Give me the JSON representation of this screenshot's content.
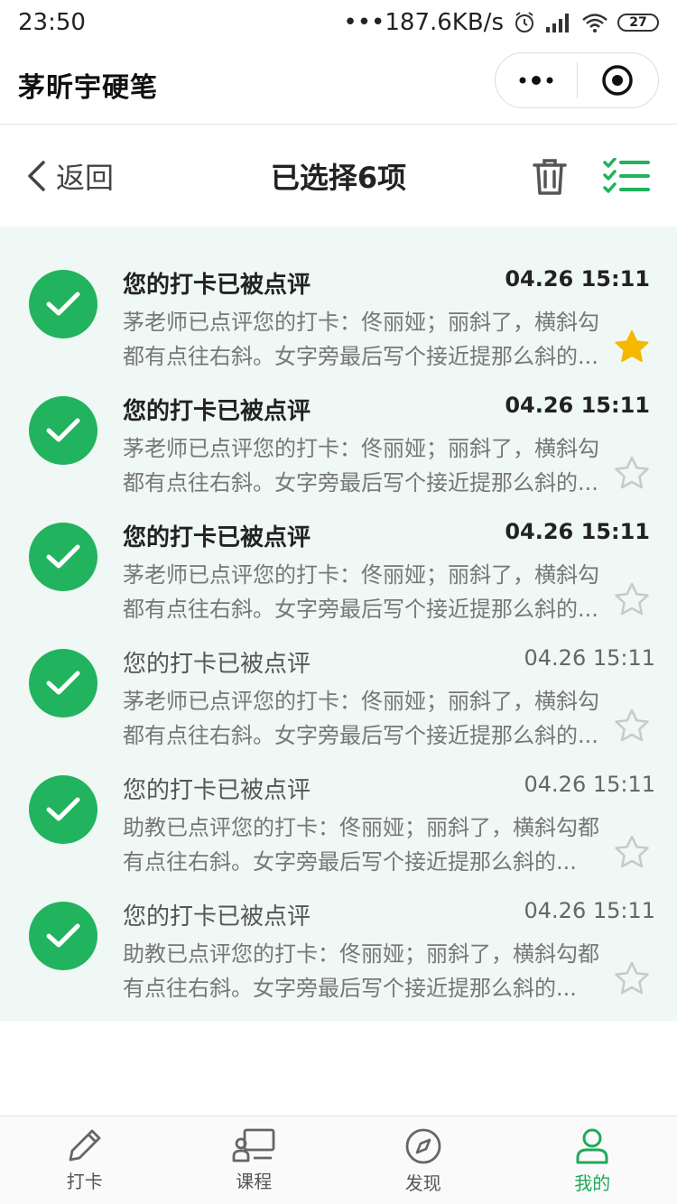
{
  "status": {
    "time": "23:50",
    "net_speed": "•••187.6KB/s",
    "battery": "27"
  },
  "app": {
    "title": "茅昕宇硬笔"
  },
  "header": {
    "back_label": "返回",
    "selection_title": "已选择6项"
  },
  "colors": {
    "accent": "#22b35e",
    "list_bg": "#eff8f4",
    "star_on": "#f5b800",
    "star_off": "#c9c9c9"
  },
  "items": [
    {
      "title": "您的打卡已被点评",
      "time": "04.26 15:11",
      "line1": "茅老师已点评您的打卡：佟丽娅；丽斜了，横斜勾",
      "line2": "都有点往右斜。女字旁最后写个接近提那么斜的...",
      "starred": true,
      "unread": true
    },
    {
      "title": "您的打卡已被点评",
      "time": "04.26 15:11",
      "line1": "茅老师已点评您的打卡：佟丽娅；丽斜了，横斜勾",
      "line2": "都有点往右斜。女字旁最后写个接近提那么斜的...",
      "starred": false,
      "unread": true
    },
    {
      "title": "您的打卡已被点评",
      "time": "04.26 15:11",
      "line1": "茅老师已点评您的打卡：佟丽娅；丽斜了，横斜勾",
      "line2": "都有点往右斜。女字旁最后写个接近提那么斜的...",
      "starred": false,
      "unread": true
    },
    {
      "title": "您的打卡已被点评",
      "time": "04.26 15:11",
      "line1": "茅老师已点评您的打卡：佟丽娅；丽斜了，横斜勾",
      "line2": "都有点往右斜。女字旁最后写个接近提那么斜的...",
      "starred": false,
      "unread": false
    },
    {
      "title": "您的打卡已被点评",
      "time": "04.26 15:11",
      "line1": "助教已点评您的打卡：佟丽娅；丽斜了，横斜勾都",
      "line2": "有点往右斜。女字旁最后写个接近提那么斜的...",
      "starred": false,
      "unread": false
    },
    {
      "title": "您的打卡已被点评",
      "time": "04.26 15:11",
      "line1": "助教已点评您的打卡：佟丽娅；丽斜了，横斜勾都",
      "line2": "有点往右斜。女字旁最后写个接近提那么斜的...",
      "starred": false,
      "unread": false
    }
  ],
  "tabs": [
    {
      "label": "打卡",
      "icon": "pencil-icon",
      "active": false
    },
    {
      "label": "课程",
      "icon": "course-icon",
      "active": false
    },
    {
      "label": "发现",
      "icon": "compass-icon",
      "active": false
    },
    {
      "label": "我的",
      "icon": "person-icon",
      "active": true
    }
  ]
}
